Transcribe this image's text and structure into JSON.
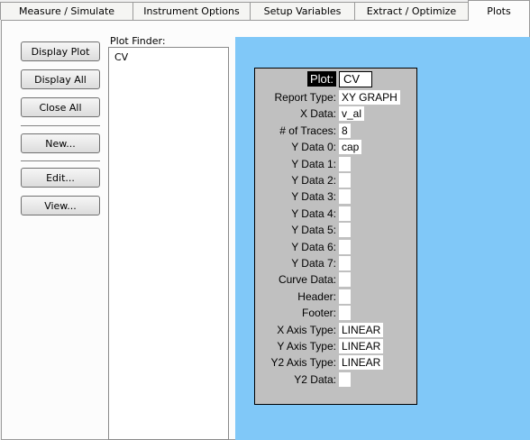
{
  "tabs": [
    {
      "label": "Measure / Simulate"
    },
    {
      "label": "Instrument Options"
    },
    {
      "label": "Setup Variables"
    },
    {
      "label": "Extract / Optimize"
    },
    {
      "label": "Plots"
    }
  ],
  "buttons": {
    "display_plot": "Display Plot",
    "display_all": "Display All",
    "close_all": "Close All",
    "new": "New...",
    "edit": "Edit...",
    "view": "View..."
  },
  "plot_finder": {
    "label": "Plot Finder:",
    "items": [
      "CV"
    ]
  },
  "plot_sheet": {
    "plot_label": "Plot:",
    "plot_name": "CV",
    "fields": [
      {
        "label": "Report Type:",
        "value": "XY GRAPH"
      },
      {
        "label": "X Data:",
        "value": "v_al"
      },
      {
        "label": "# of Traces:",
        "value": "8"
      },
      {
        "label": "Y Data 0:",
        "value": "cap"
      },
      {
        "label": "Y Data 1:",
        "value": ""
      },
      {
        "label": "Y Data 2:",
        "value": ""
      },
      {
        "label": "Y Data 3:",
        "value": ""
      },
      {
        "label": "Y Data 4:",
        "value": ""
      },
      {
        "label": "Y Data 5:",
        "value": ""
      },
      {
        "label": "Y Data 6:",
        "value": ""
      },
      {
        "label": "Y Data 7:",
        "value": ""
      },
      {
        "label": "Curve Data:",
        "value": ""
      },
      {
        "label": "Header:",
        "value": ""
      },
      {
        "label": "Footer:",
        "value": ""
      },
      {
        "label": "X Axis Type:",
        "value": "LINEAR"
      },
      {
        "label": "Y Axis Type:",
        "value": "LINEAR"
      },
      {
        "label": "Y2 Axis Type:",
        "value": "LINEAR"
      },
      {
        "label": "Y2 Data:",
        "value": ""
      }
    ]
  },
  "colors": {
    "sheet_background": "#80c8f8",
    "table_background": "#c0c0c0"
  }
}
